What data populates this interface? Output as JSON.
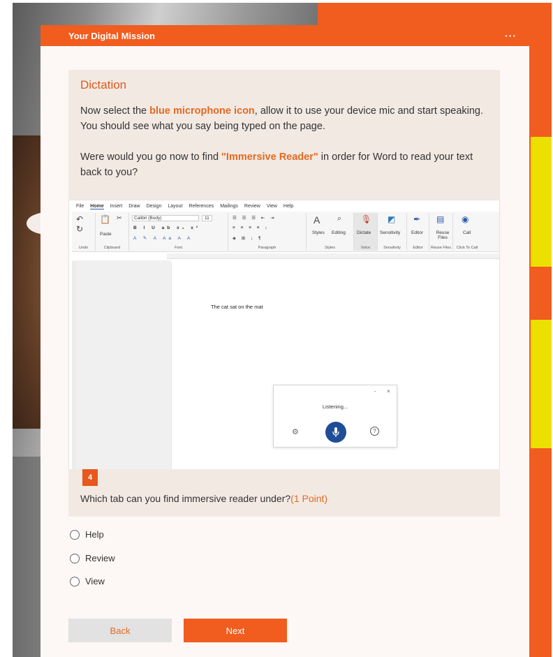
{
  "header": {
    "title": "Your Digital Mission",
    "more_label": "···"
  },
  "section": {
    "title": "Dictation",
    "p1_pre": "Now select the ",
    "p1_highlight": "blue microphone icon",
    "p1_post": ", allow it to use your device mic and start speaking. You should see what you say being typed on the page.",
    "p2_pre": "Were would you go now to find ",
    "p2_highlight": "\"Immersive Reader\"",
    "p2_post": " in order for Word to read your text back to you?"
  },
  "word": {
    "menu": [
      "File",
      "Home",
      "Insert",
      "Draw",
      "Design",
      "Layout",
      "References",
      "Mailings",
      "Review",
      "View",
      "Help"
    ],
    "font_name": "Calibri (Body)",
    "font_size": "11",
    "groups": [
      "Undo",
      "Clipboard",
      "Font",
      "Paragraph",
      "Styles",
      "Voice",
      "Sensitivity",
      "Editor",
      "Reuse Files",
      "Click To Call"
    ],
    "buttons": {
      "paste": "Paste",
      "styles": "Styles",
      "editing": "Editing",
      "dictate": "Dictate",
      "sensitivity": "Sensitivity",
      "editor": "Editor",
      "reuse": "Reuse Files",
      "call": "Call"
    },
    "doc_text": "The cat sat on the mat",
    "listening": "Listening...",
    "minimize": "-",
    "close": "×",
    "help": "?"
  },
  "question": {
    "number": "4",
    "text": "Which tab can you find immersive reader under?",
    "points": "(1 Point)",
    "options": [
      "Help",
      "Review",
      "View"
    ]
  },
  "nav": {
    "back": "Back",
    "next": "Next"
  },
  "colors": {
    "accent": "#f15c1f",
    "highlight": "#e26a21",
    "mic_blue": "#1f4e97",
    "yellow": "#ece000"
  }
}
